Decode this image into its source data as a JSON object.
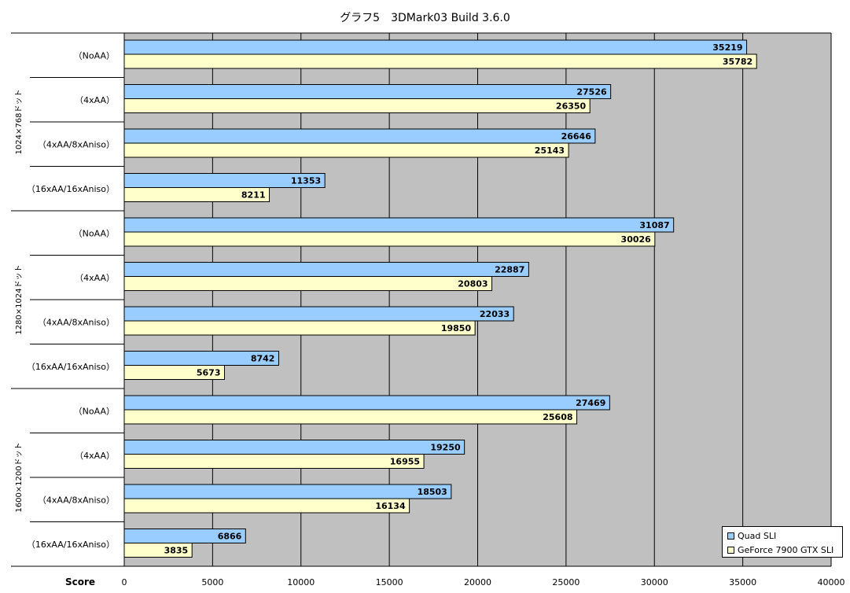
{
  "chart_data": {
    "type": "bar",
    "orientation": "horizontal",
    "title": "グラフ5　3DMark03 Build 3.6.0",
    "xlabel": "Score",
    "xlim": [
      0,
      40000
    ],
    "xticks": [
      0,
      5000,
      10000,
      15000,
      20000,
      25000,
      30000,
      35000,
      40000
    ],
    "grid": true,
    "legend_position": "bottom-right",
    "groups": [
      {
        "label": "1024×768ドット",
        "categories": [
          "（NoAA）",
          "（4xAA）",
          "（4xAA/8xAniso）",
          "（16xAA/16xAniso）"
        ]
      },
      {
        "label": "1280×1024ドット",
        "categories": [
          "（NoAA）",
          "（4xAA）",
          "（4xAA/8xAniso）",
          "（16xAA/16xAniso）"
        ]
      },
      {
        "label": "1600×1200ドット",
        "categories": [
          "（NoAA）",
          "（4xAA）",
          "（4xAA/8xAniso）",
          "（16xAA/16xAniso）"
        ]
      }
    ],
    "series": [
      {
        "name": "Quad SLI",
        "color": "#99ccff",
        "values": [
          35219,
          27526,
          26646,
          11353,
          31087,
          22887,
          22033,
          8742,
          27469,
          19250,
          18503,
          6866
        ]
      },
      {
        "name": "GeForce 7900 GTX SLI",
        "color": "#ffffcc",
        "values": [
          35782,
          26350,
          25143,
          8211,
          30026,
          20803,
          19850,
          5673,
          25608,
          16955,
          16134,
          3835
        ]
      }
    ],
    "plot_background": "#c0c0c0"
  }
}
